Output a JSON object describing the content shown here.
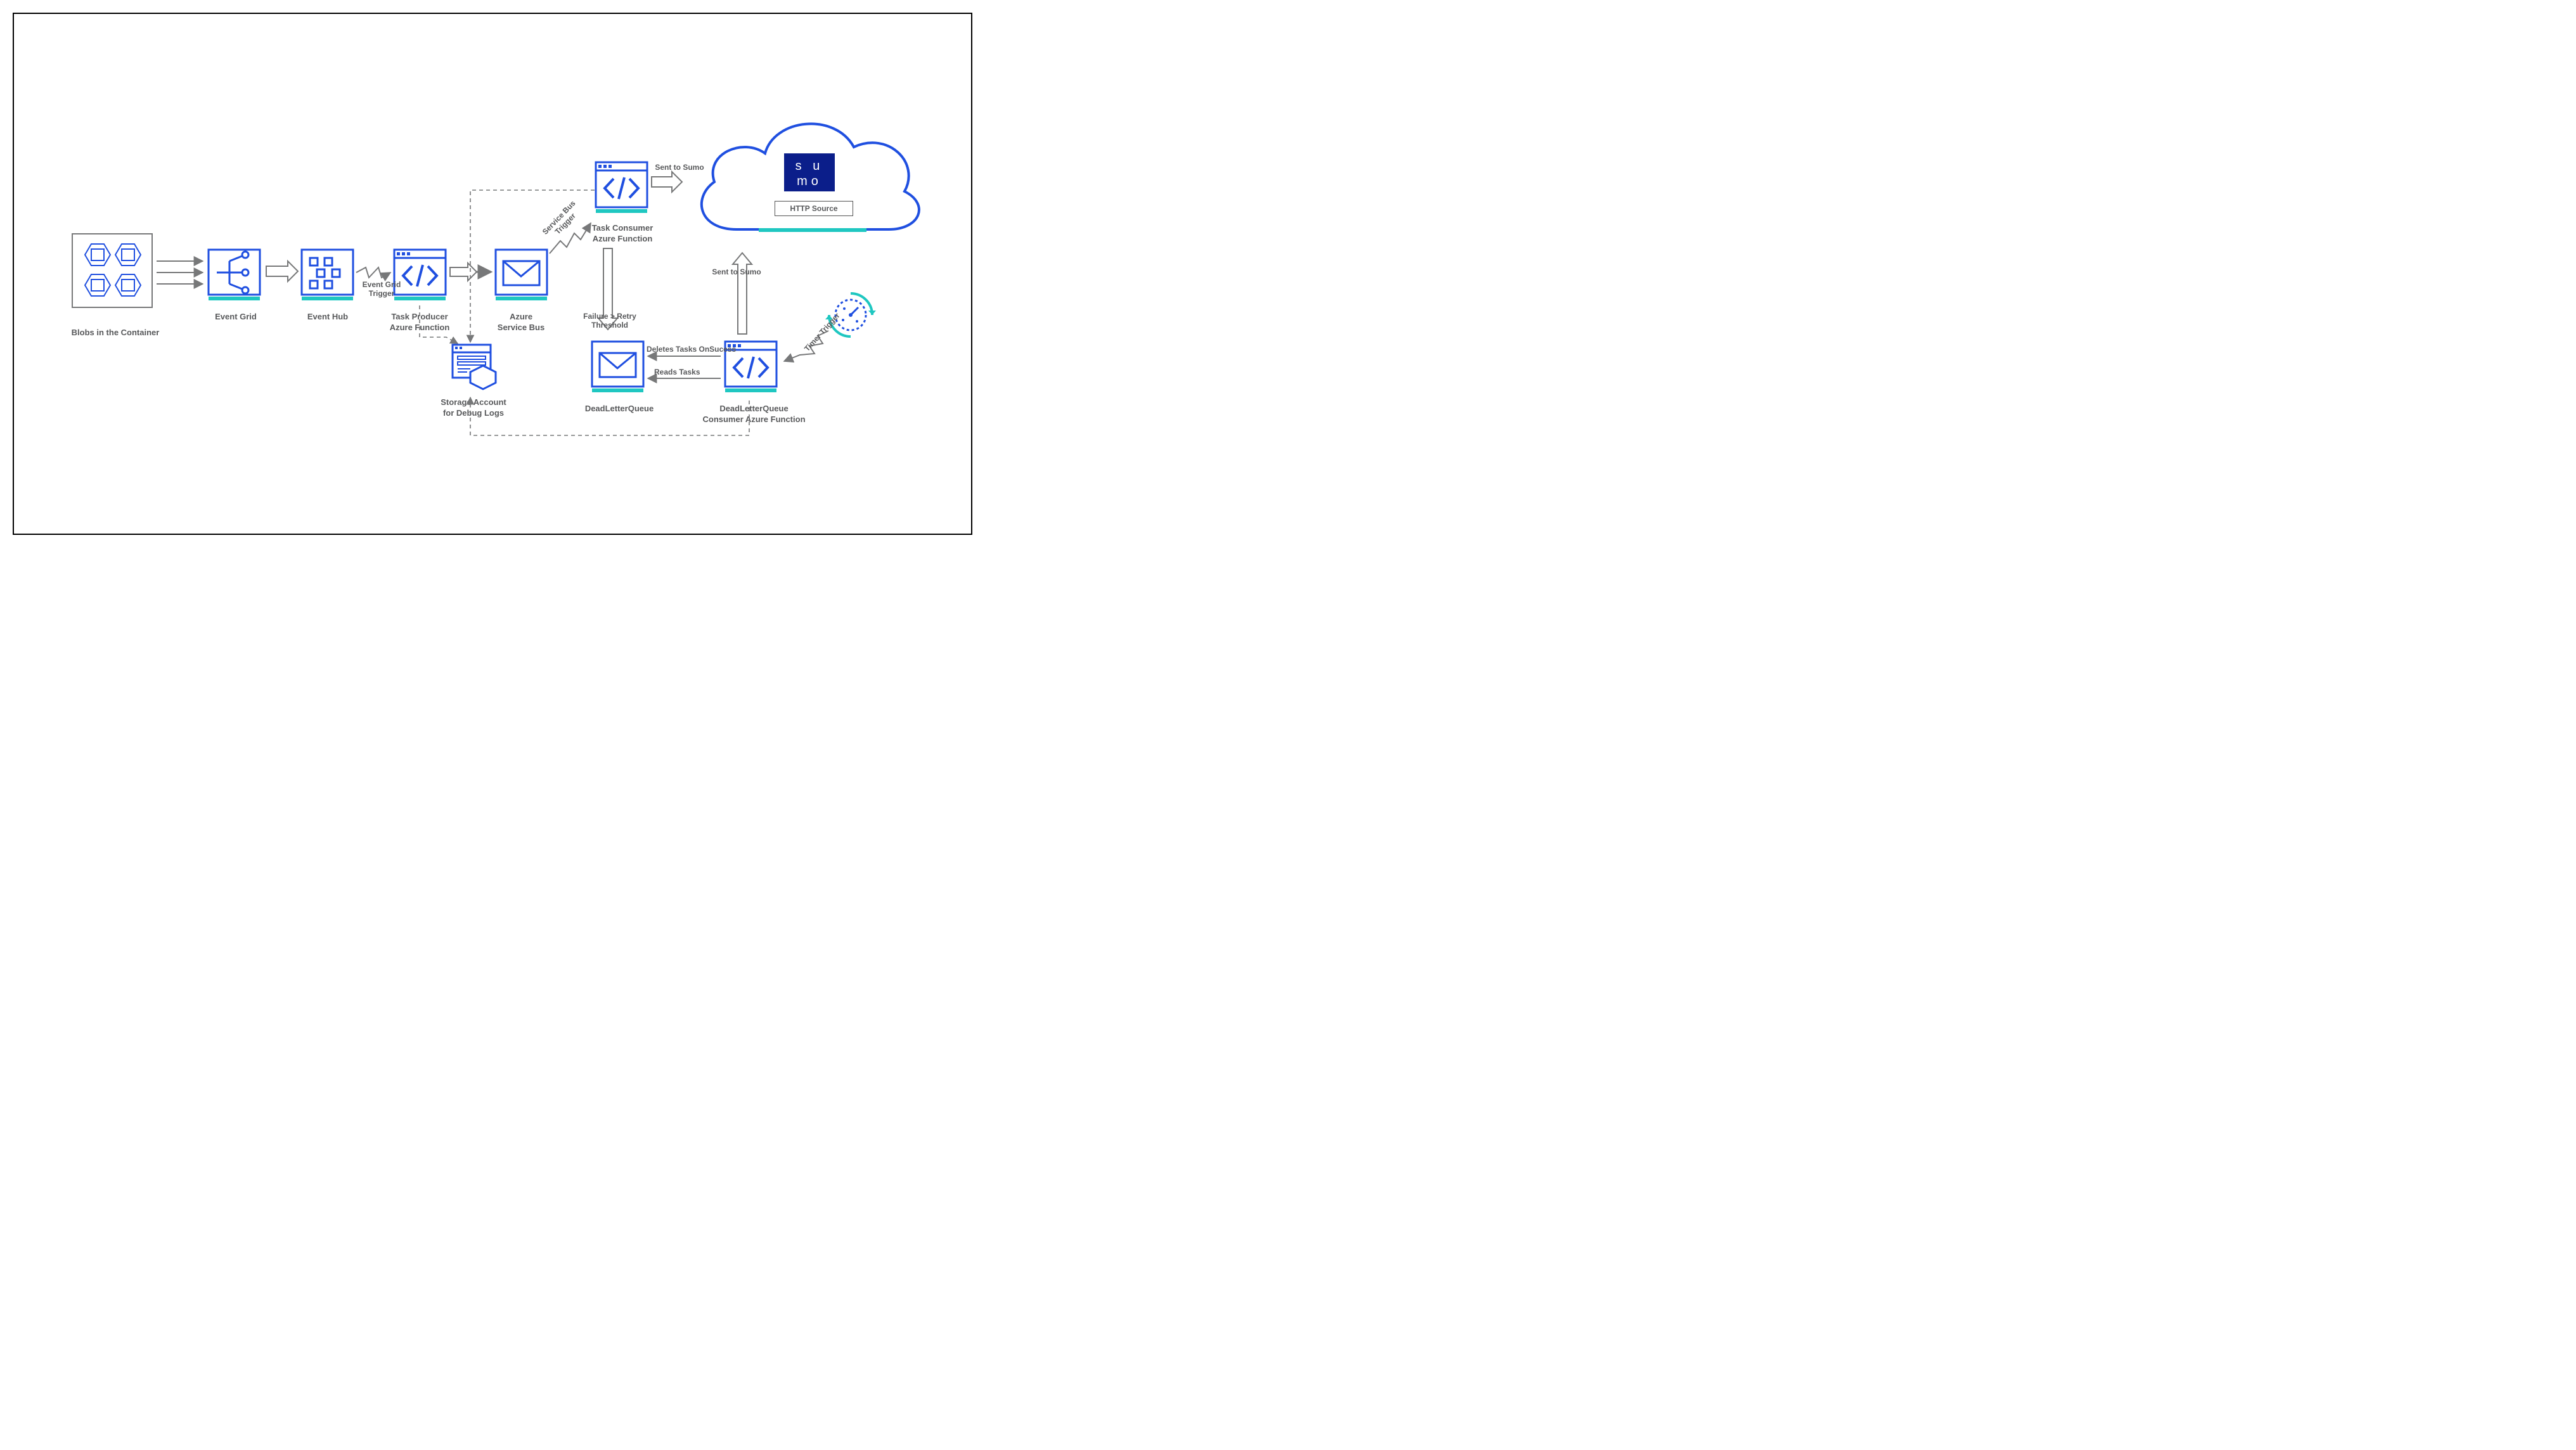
{
  "colors": {
    "azure": "#1f4fe0",
    "teal": "#1fc7c1",
    "gray": "#777879",
    "text": "#58595b",
    "sumoNavy": "#0b1e8a"
  },
  "nodes": {
    "blobs": {
      "label": "Blobs in the Container"
    },
    "eventGrid": {
      "label": "Event Grid"
    },
    "eventHub": {
      "label": "Event Hub"
    },
    "taskProducer": {
      "label": "Task Producer\nAzure Function"
    },
    "serviceBus": {
      "label": "Azure\nService Bus"
    },
    "taskConsumer": {
      "label": "Task Consumer\nAzure Function"
    },
    "storage": {
      "label": "Storage Account\nfor Debug Logs"
    },
    "dlq": {
      "label": "DeadLetterQueue"
    },
    "dlqConsumer": {
      "label": "DeadLetterQueue\nConsumer Azure Function"
    },
    "timer": {
      "label": ""
    },
    "cloud": {
      "httpSource": "HTTP Source",
      "sumo": "sumo"
    }
  },
  "edges": {
    "eventGridTrigger": "Event Grid\nTrigger",
    "sbTrigger": "Service Bus\nTrigger",
    "sentToSumo1": "Sent to Sumo",
    "failureRetry": "Failure > Retry\nThreshold",
    "deletesTasks": "Deletes Tasks OnSucess",
    "readsTasks": "Reads Tasks",
    "sentToSumo2": "Sent to Sumo",
    "timerTrigger": "Timer Trigger"
  }
}
